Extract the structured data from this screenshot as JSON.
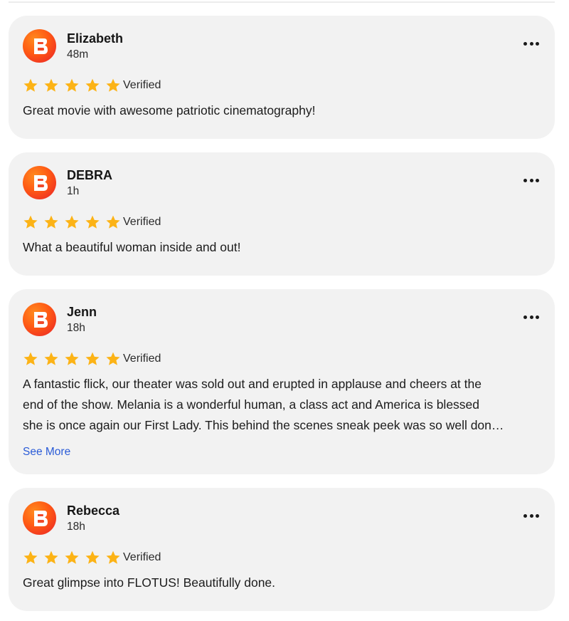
{
  "reviews": [
    {
      "name": "Elizabeth",
      "time": "48m",
      "rating": 5,
      "badge": "Verified",
      "text": "Great movie with awesome patriotic cinematography!",
      "see_more": ""
    },
    {
      "name": "DEBRA",
      "time": "1h",
      "rating": 5,
      "badge": "Verified",
      "text": "What a beautiful woman inside and out!",
      "see_more": ""
    },
    {
      "name": "Jenn",
      "time": "18h",
      "rating": 5,
      "badge": "Verified",
      "text_lines": [
        "A fantastic flick, our theater was sold out and erupted in applause and cheers at the",
        "end of the show. Melania is a wonderful human, a class act and America is blessed",
        "she is once again our First Lady. This behind the scenes sneak peek was so well don…"
      ],
      "see_more": "See More"
    },
    {
      "name": "Rebecca",
      "time": "18h",
      "rating": 5,
      "badge": "Verified",
      "text": "Great glimpse into FLOTUS! Beautifully done.",
      "see_more": ""
    }
  ],
  "colors": {
    "star": "#fcb316",
    "link": "#2a5bd7",
    "card_bg": "#f2f2f2"
  },
  "icons": {
    "avatar": "fandango-logo-icon",
    "star": "star-icon",
    "more": "more-options-icon"
  }
}
